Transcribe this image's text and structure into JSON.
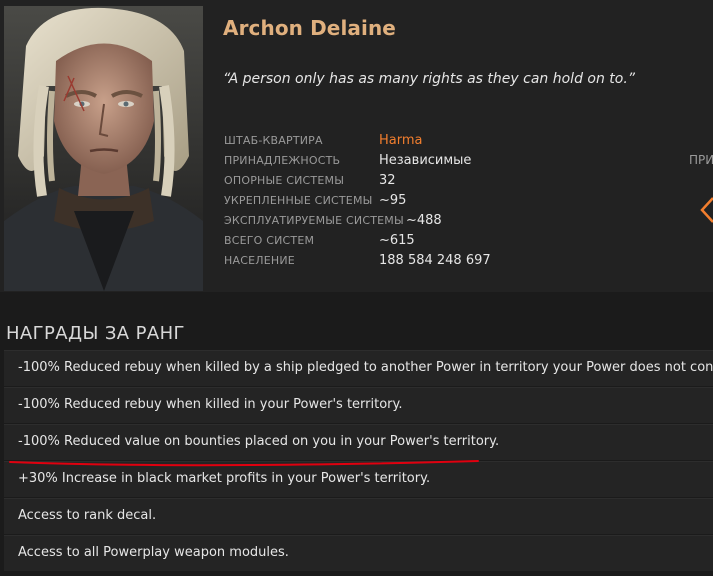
{
  "leader": {
    "name": "Archon Delaine",
    "quote": "“A person only has as many rights as they can hold on to.”"
  },
  "stats": [
    {
      "label": "ШТАБ-КВАРТИРА",
      "value": "Harma",
      "highlight": true
    },
    {
      "label": "ПРИНАДЛЕЖНОСТЬ",
      "value": "Независимые"
    },
    {
      "label": "ОПОРНЫЕ СИСТЕМЫ",
      "value": "32"
    },
    {
      "label": "УКРЕПЛЕННЫЕ СИСТЕМЫ",
      "value": "~95"
    },
    {
      "label": "ЭКСПЛУАТИРУЕМЫЕ СИСТЕМЫ",
      "value": "~488"
    },
    {
      "label": "ВСЕГО СИСТЕМ",
      "value": "~615"
    },
    {
      "label": "НАСЕЛЕНИЕ",
      "value": "188 584 248 697"
    }
  ],
  "side_label_clipped": "ПРИ",
  "rewards": {
    "title": "НАГРАДЫ ЗА РАНГ",
    "items": [
      "-100% Reduced rebuy when killed by a ship pledged to another Power in territory your Power does not control.",
      "-100% Reduced rebuy when killed in your Power's territory.",
      "-100% Reduced value on bounties placed on you in your Power's territory.",
      "+30% Increase in black market profits in your Power's territory.",
      "Access to rank decal.",
      "Access to all Powerplay weapon modules."
    ]
  },
  "colors": {
    "name": "#e0b07e",
    "hq": "#f27e2e",
    "chevron": "#f27e2e",
    "annotation": "#e0000f"
  },
  "icons": {
    "nav": "chevron-left-icon"
  }
}
